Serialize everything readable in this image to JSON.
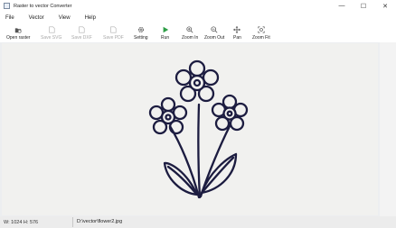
{
  "window": {
    "title": "Raster to vector Converter",
    "controls": [
      "—",
      "☐",
      "✕"
    ]
  },
  "menu": [
    "File",
    "Vector",
    "View",
    "Help"
  ],
  "toolbar": [
    {
      "label": "Open raster",
      "icon": "open-icon",
      "enabled": true
    },
    {
      "label": "Save SVG",
      "icon": "save-svg-icon",
      "enabled": false
    },
    {
      "label": "Save DXF",
      "icon": "save-dxf-icon",
      "enabled": false
    },
    {
      "label": "Save PDF",
      "icon": "save-pdf-icon",
      "enabled": false
    },
    {
      "label": "Setting",
      "icon": "gear-icon",
      "enabled": true
    },
    {
      "label": "Run",
      "icon": "run-icon",
      "enabled": true
    },
    {
      "label": "Zoom In",
      "icon": "zoom-in-icon",
      "enabled": true
    },
    {
      "label": "Zoom Out",
      "icon": "zoom-out-icon",
      "enabled": true
    },
    {
      "label": "Pan",
      "icon": "pan-icon",
      "enabled": true
    },
    {
      "label": "Zoom Fit",
      "icon": "zoom-fit-icon",
      "enabled": true
    }
  ],
  "status": {
    "dimensions": "W: 1024  H: 576",
    "path": "D:\\vector\\flower2.jpg"
  },
  "colors": {
    "run_green": "#2e9e47",
    "drawing_stroke": "#1c1c40"
  }
}
